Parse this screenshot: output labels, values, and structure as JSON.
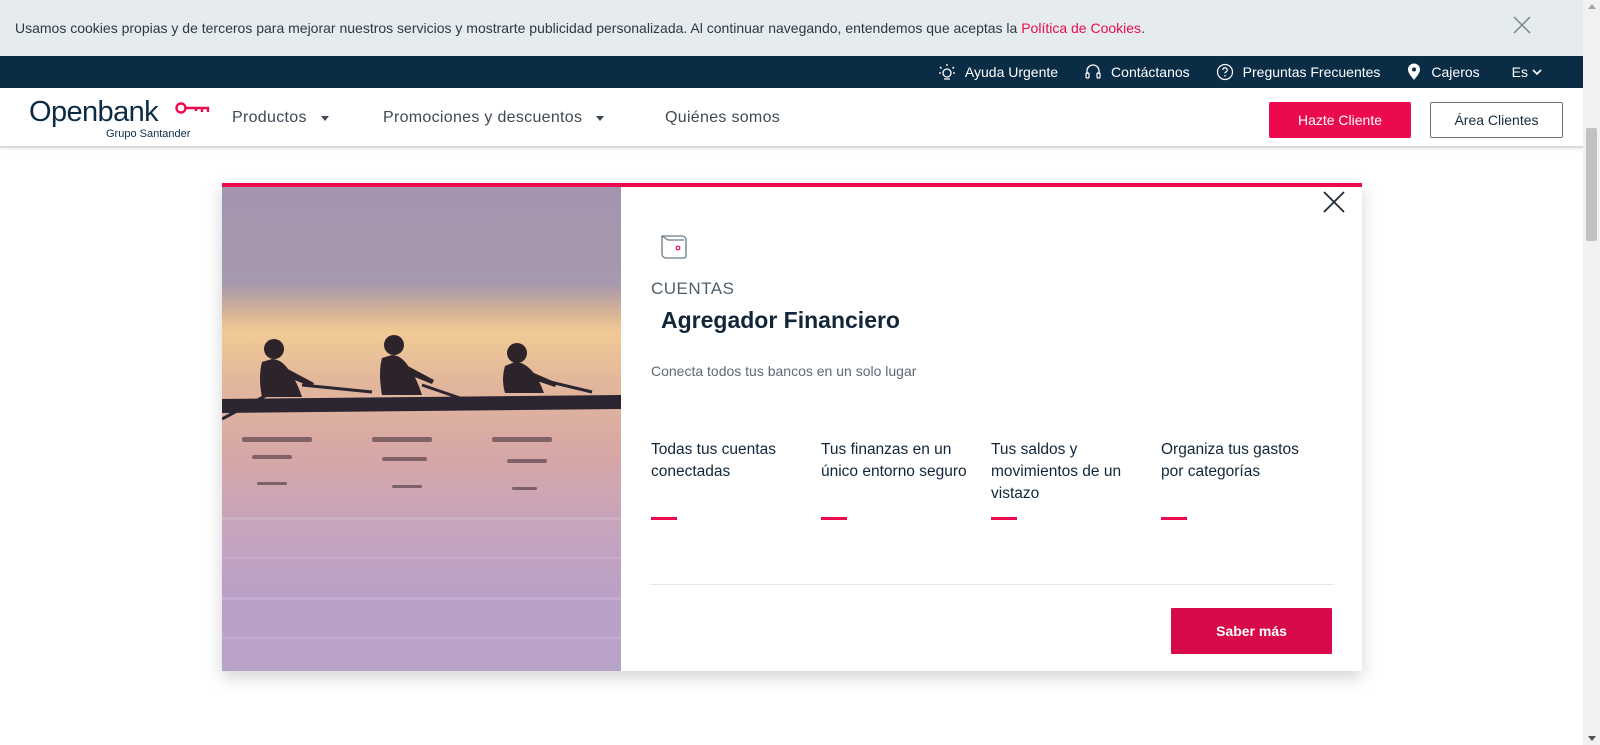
{
  "cookie_bar": {
    "text": "Usamos cookies propias y de terceros para mejorar nuestros servicios y mostrarte publicidad personalizada. Al continuar navegando, entendemos que aceptas la ",
    "link": "Política de Cookies",
    "period": "."
  },
  "util_bar": {
    "items": [
      {
        "label": "Ayuda Urgente",
        "icon": "lightbulb-icon"
      },
      {
        "label": "Contáctanos",
        "icon": "headset-icon"
      },
      {
        "label": "Preguntas Frecuentes",
        "icon": "question-icon"
      },
      {
        "label": "Cajeros",
        "icon": "location-pin-icon"
      }
    ],
    "language": "Es"
  },
  "nav": {
    "logo": {
      "name": "Openbank",
      "subtitle": "Grupo Santander"
    },
    "items": [
      {
        "label": "Productos"
      },
      {
        "label": "Promociones y descuentos"
      },
      {
        "label": "Quiénes somos"
      }
    ],
    "cta_primary": "Hazte Cliente",
    "cta_secondary": "Área Clientes"
  },
  "card": {
    "category": "CUENTAS",
    "title": "Agregador Financiero",
    "description": "Conecta todos tus bancos en un solo lugar",
    "features": [
      {
        "text": "Todas tus cuentas conectadas"
      },
      {
        "text": "Tus finanzas en un único entorno seguro"
      },
      {
        "text": "Tus saldos y movimientos de un vistazo"
      },
      {
        "text": "Organiza tus gastos por categorías"
      }
    ],
    "button": "Saber más"
  },
  "colors": {
    "brand_red": "#ec0a4f",
    "navy": "#0b2c45",
    "cookie_bg": "#e6ebed"
  }
}
